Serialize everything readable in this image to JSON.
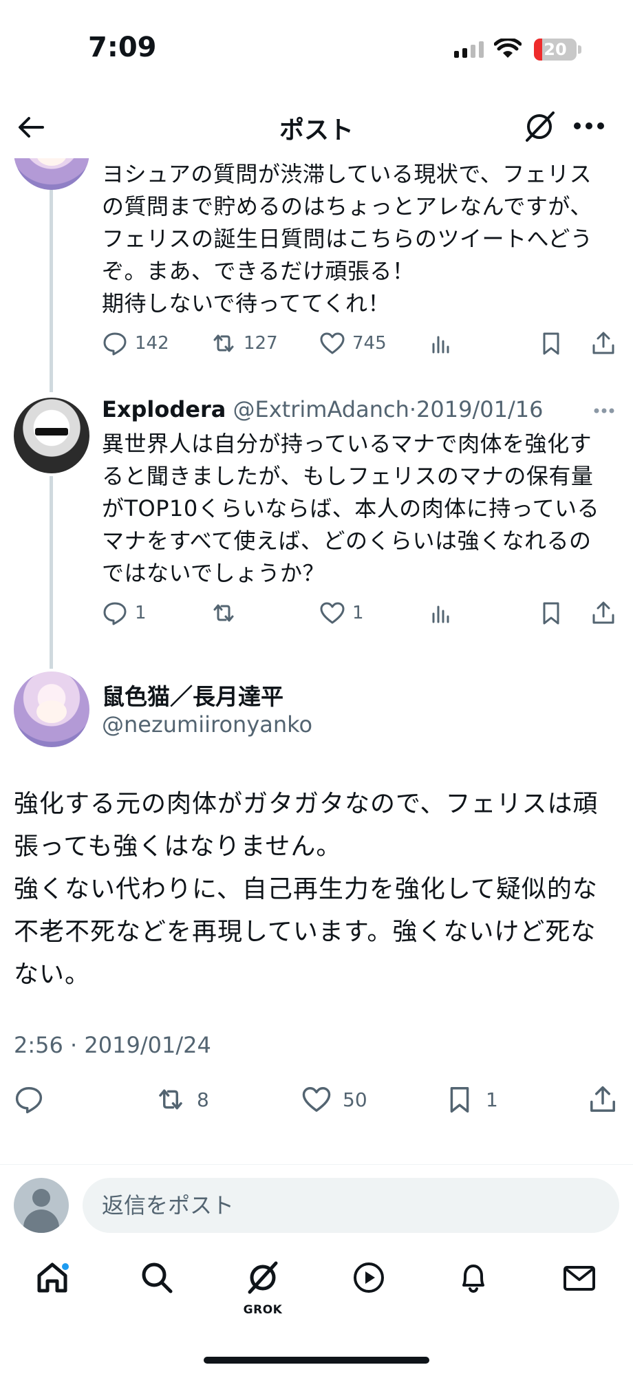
{
  "status_bar": {
    "time": "7:09",
    "battery_level": "20"
  },
  "header": {
    "title": "ポスト"
  },
  "thread": [
    {
      "text": "ヨシュアの質問が渋滞している現状で、フェリスの質問まで貯めるのはちょっとアレなんですが、フェリスの誕生日質問はこちらのツイートへどうぞ。まあ、できるだけ頑張る！\n期待しないで待っててくれ！",
      "replies": "142",
      "reposts": "127",
      "likes": "745"
    },
    {
      "name": "Explodera",
      "handle": "@ExtrimAdanch",
      "date": "2019/01/16",
      "text": "異世界人は自分が持っているマナで肉体を強化すると聞きましたが、もしフェリスのマナの保有量がTOP10くらいならば、本人の肉体に持っているマナをすべて使えば、どのくらいは強くなれるのではないでしょうか？",
      "replies": "1",
      "reposts": "",
      "likes": "1"
    }
  ],
  "main_post": {
    "name": "鼠色猫／長月達平",
    "handle": "@nezumiironyanko",
    "text": "強化する元の肉体がガタガタなので、フェリスは頑張っても強くはなりません。\n強くない代わりに、自己再生力を強化して疑似的な不老不死などを再現しています。強くないけど死なない。",
    "time": "2:56 · 2019/01/24",
    "reposts": "8",
    "likes": "50",
    "bookmarks": "1"
  },
  "reply_bar": {
    "placeholder": "返信をポスト"
  },
  "tabbar": {
    "grok_label": "GROK"
  },
  "colors": {
    "accent": "#1d9bf0",
    "text": "#0f1419",
    "secondary": "#536471",
    "battery_low": "#ee2b2b"
  }
}
